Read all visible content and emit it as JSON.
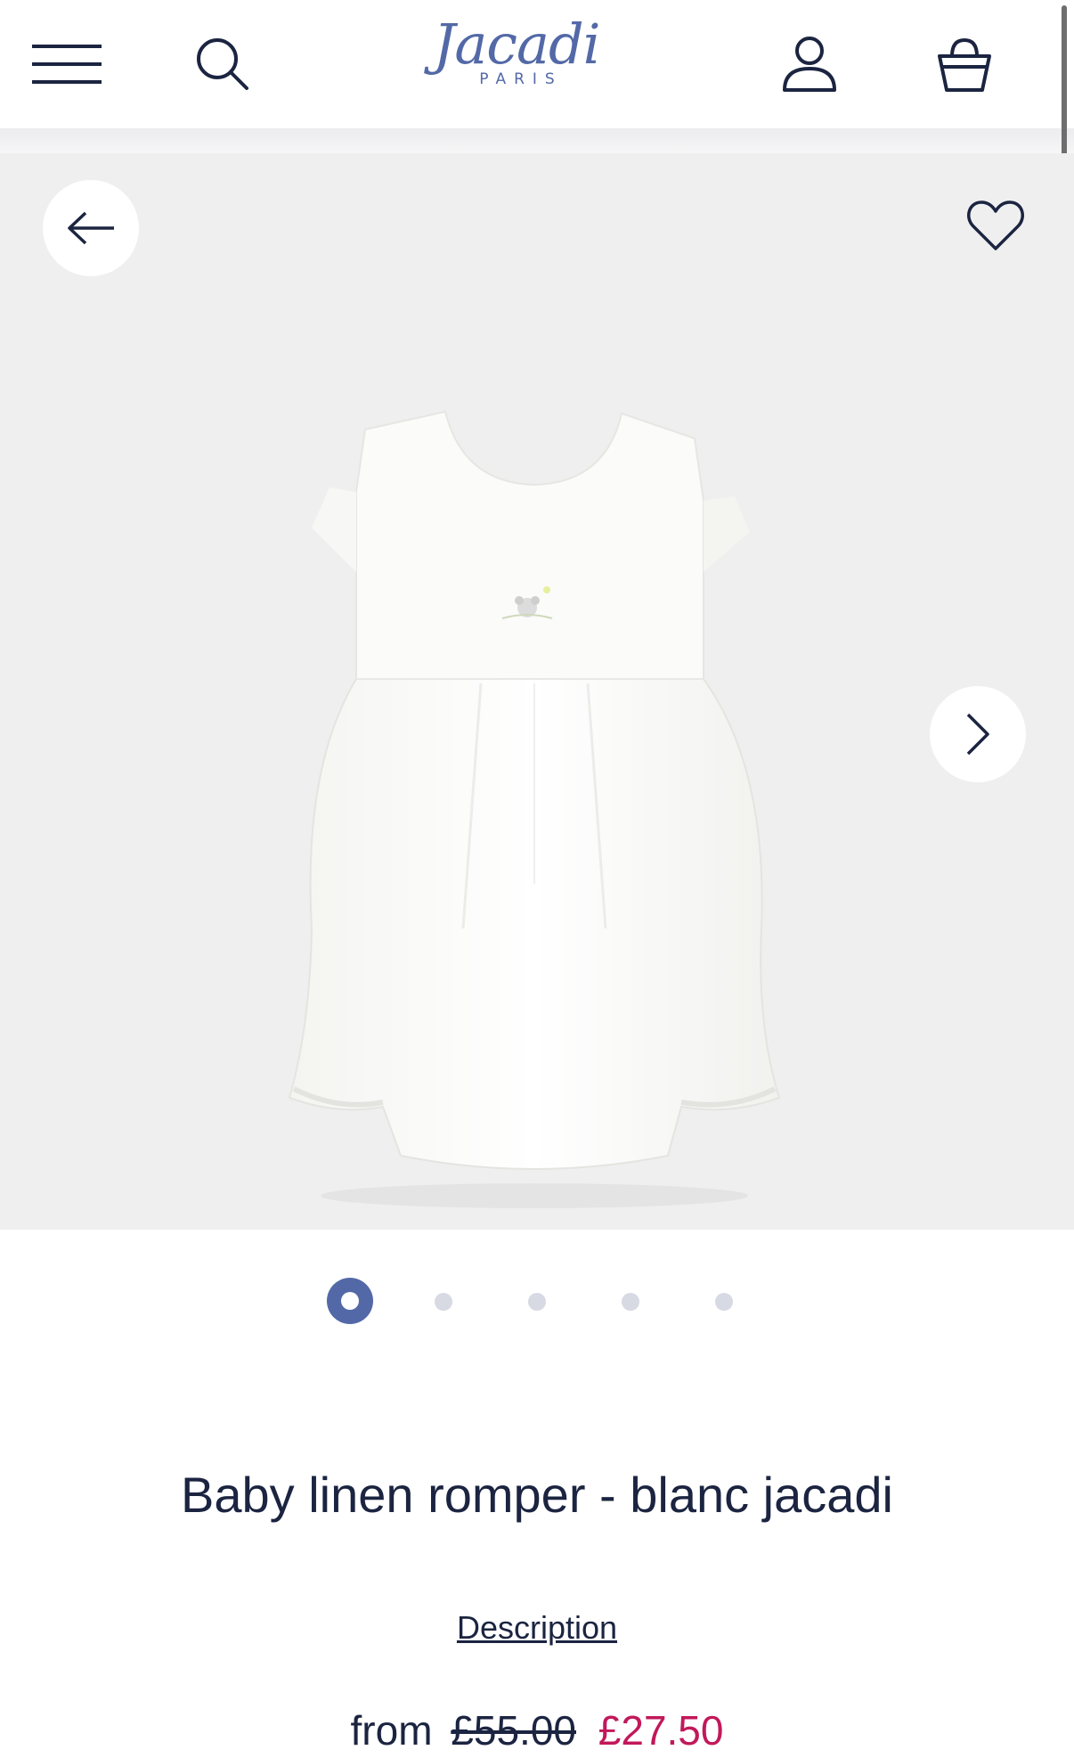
{
  "header": {
    "logo_script": "Jacadi",
    "logo_sub": "PARIS",
    "menu_icon": "hamburger-menu-icon",
    "search_icon": "search-icon",
    "account_icon": "user-account-icon",
    "bag_icon": "shopping-bag-icon"
  },
  "gallery": {
    "prev_icon": "arrow-left-icon",
    "next_icon": "chevron-right-icon",
    "wishlist_icon": "heart-icon",
    "image_alt": "Baby linen romper - blanc jacadi",
    "slide_count": 5,
    "active_slide": 1
  },
  "product": {
    "title": "Baby linen romper - blanc jacadi",
    "description_link": "Description",
    "price_prefix": "from",
    "price_old": "£55.00",
    "price_new": "£27.50"
  },
  "colors": {
    "brand": "#5369a7",
    "text": "#1b2440",
    "sale": "#c2185b",
    "gallery_bg": "#efefef"
  }
}
